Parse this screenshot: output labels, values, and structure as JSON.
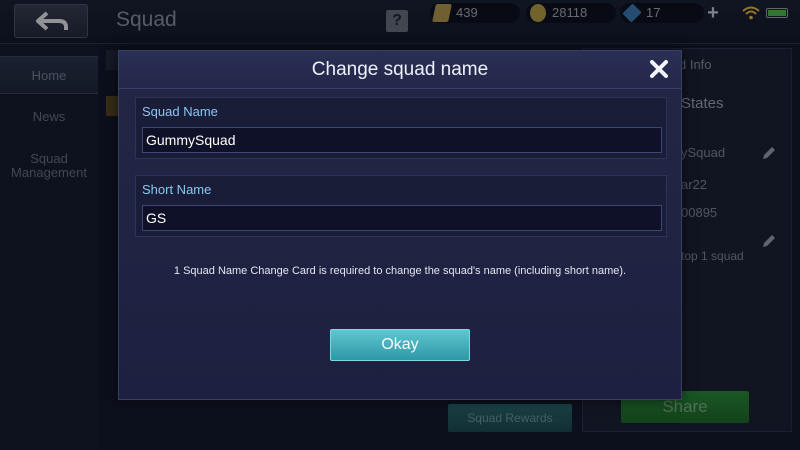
{
  "screen": {
    "title": "Squad",
    "help_symbol": "?"
  },
  "resources": [
    {
      "icon": "ticket-icon",
      "value": "439"
    },
    {
      "icon": "gold-coin-icon",
      "value": "28118"
    },
    {
      "icon": "diamond-icon",
      "value": "17"
    }
  ],
  "nav": {
    "home": "Home",
    "news": "News",
    "squad_management": "Squad Management"
  },
  "right_panel": {
    "title_partial": "d Info",
    "states": "States",
    "name_partial": "ySquad",
    "line2_partial": "ar22",
    "line3_partial": "00895",
    "rank_partial": "top 1 squad",
    "share_label": "Share"
  },
  "squad_rewards_label": "Squad Rewards",
  "modal": {
    "title": "Change squad name",
    "squad_name_label": "Squad Name",
    "squad_name_value": "GummySquad",
    "short_name_label": "Short Name",
    "short_name_value": "GS",
    "notice": "1 Squad Name Change Card is required to change the squad's name (including short name).",
    "okay_label": "Okay"
  },
  "colors": {
    "accent_label": "#89c7f2",
    "okay_button": "#3fb0bd",
    "share_button": "#2d8e3d"
  }
}
